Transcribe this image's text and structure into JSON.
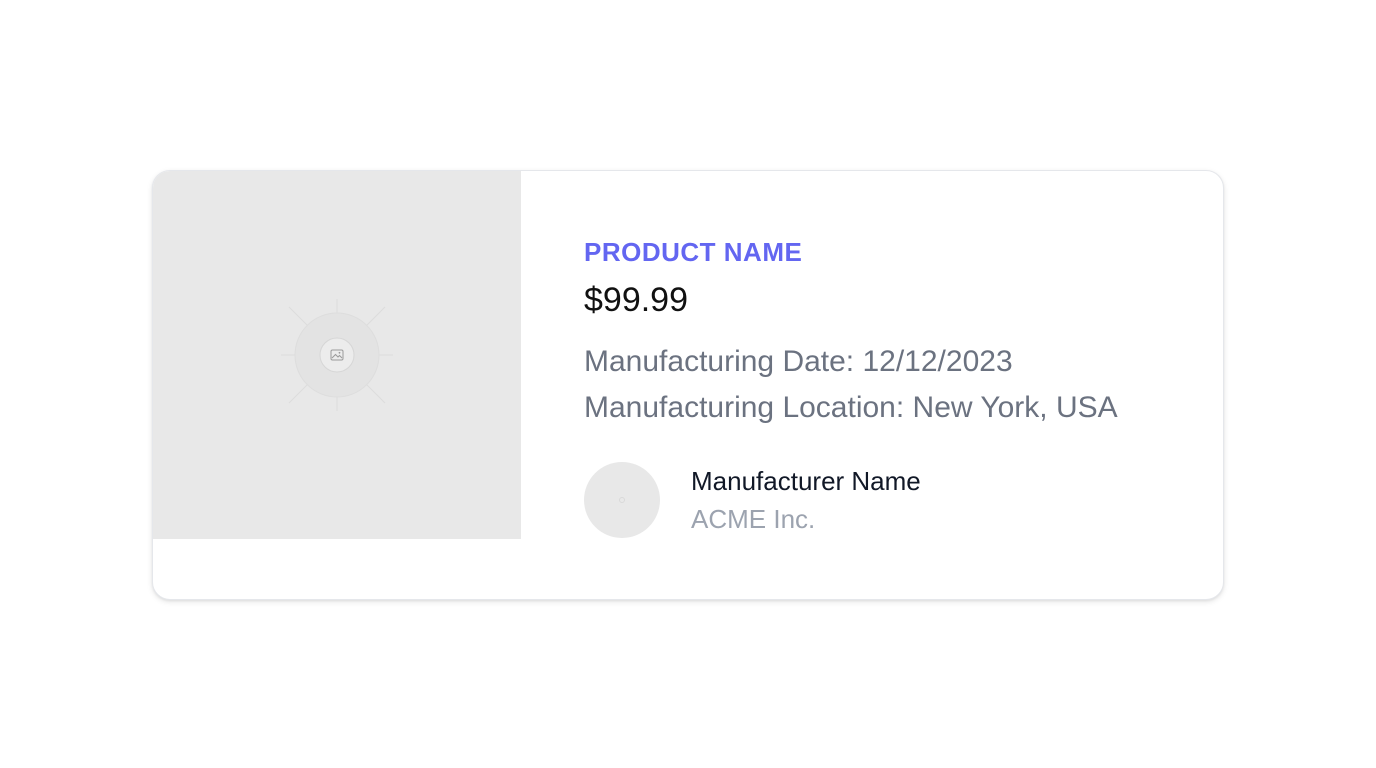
{
  "product": {
    "name": "PRODUCT NAME",
    "price": "$99.99",
    "manufacturing_date": "Manufacturing Date: 12/12/2023",
    "manufacturing_location": "Manufacturing Location: New York, USA"
  },
  "manufacturer": {
    "label": "Manufacturer Name",
    "name": "ACME Inc."
  },
  "colors": {
    "accent": "#6366f1",
    "muted_text": "#6b7280",
    "light_text": "#9ca3af",
    "placeholder_bg": "#e8e8e8"
  },
  "icons": {
    "product_image": "image-placeholder-icon",
    "avatar": "avatar-placeholder-icon"
  }
}
